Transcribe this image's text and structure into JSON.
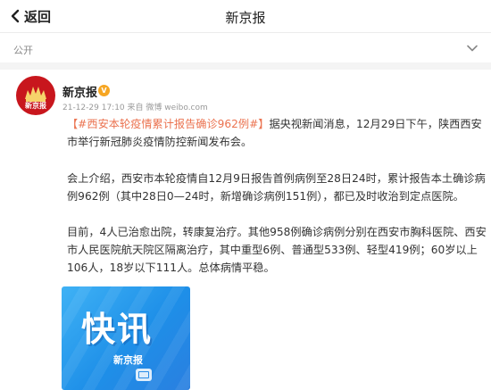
{
  "header": {
    "back_label": "返回",
    "title": "新京报"
  },
  "visibility": {
    "label": "公开"
  },
  "post": {
    "author": "新京报",
    "badge": "V",
    "meta": "21-12-29 17:10 来自 微博 weibo.com",
    "avatar_text": "新京报",
    "paragraph1_tag": "【#西安本轮疫情累计报告确诊962例#】",
    "paragraph1_rest": "据央视新闻消息，12月29日下午，陕西西安市举行新冠肺炎疫情防控新闻发布会。",
    "paragraph2": "会上介绍，西安市本轮疫情自12月9日报告首例病例至28日24时，累计报告本土确诊病例962例（其中28日0—24时，新增确诊病例151例），都已及时收治到定点医院。",
    "paragraph3": "目前，4人已治愈出院，转康复治疗。其他958例确诊病例分别在西安市胸科医院、西安市人民医院航天院区隔离治疗，其中重型6例、普通型533例、轻型419例；60岁以上106人，18岁以下111人。总体病情平稳。",
    "image": {
      "big_text": "快讯",
      "sub_text": "新京报"
    }
  },
  "colors": {
    "accent_link": "#eb7350",
    "brand_red": "#c8161d",
    "image_blue": "#1e8fe8"
  }
}
